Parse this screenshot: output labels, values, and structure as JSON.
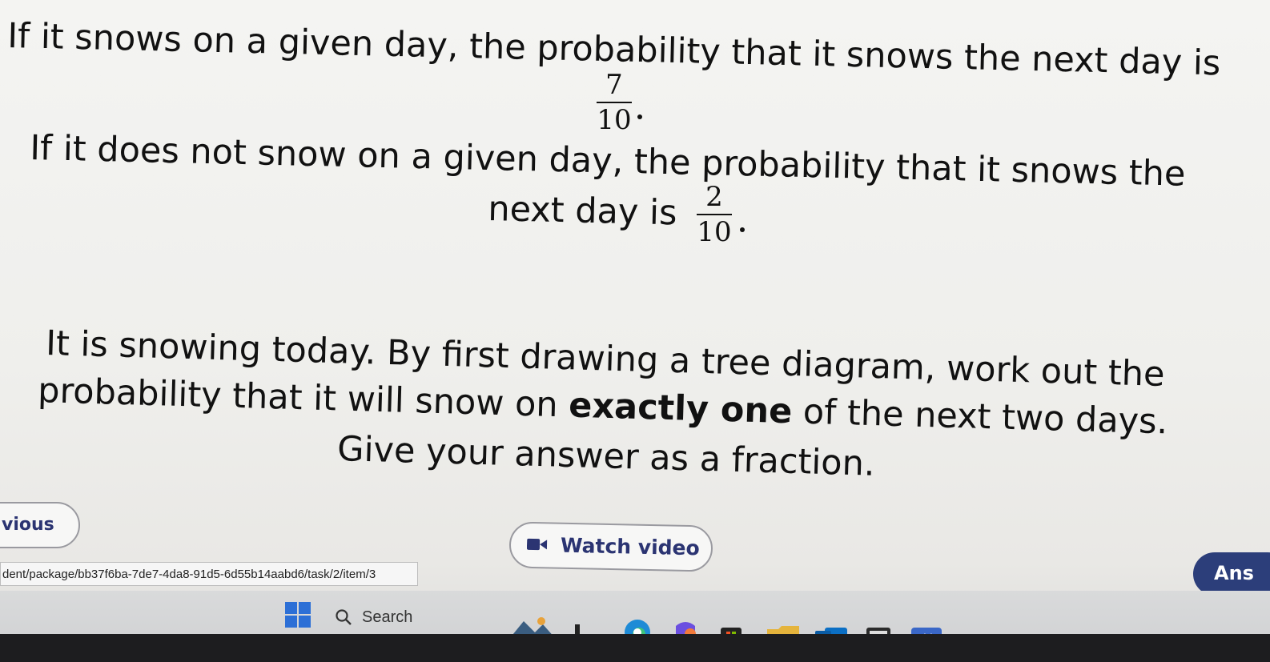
{
  "question": {
    "line1": "If it snows on a given day, the probability that it snows the next day is",
    "frac1": {
      "num": "7",
      "den": "10"
    },
    "line2": "If it does not snow on a given day, the probability that it snows the",
    "line3": "next day is",
    "frac2": {
      "num": "2",
      "den": "10"
    },
    "line4": "It is snowing today. By first drawing a tree diagram, work out the",
    "line5_before": "probability that it will snow on ",
    "line5_bold": "exactly one",
    "line5_after": " of the next two days.",
    "line6": "Give your answer as a fraction."
  },
  "buttons": {
    "previous": "vious",
    "watch_video": "Watch video",
    "answer": "Ans"
  },
  "url_tooltip": "dent/package/bb37f6ba-7de7-4da8-91d5-6d55b14aabd6/task/2/item/3",
  "taskbar": {
    "search_placeholder": "Search",
    "icons": [
      "windows-start-icon",
      "search-icon",
      "photos-icon",
      "file-explorer-icon",
      "edge-icon",
      "copilot-icon",
      "store-icon",
      "folder-icon",
      "outlook-icon",
      "calculator-icon",
      "whiteboard-icon"
    ]
  },
  "colors": {
    "button_text": "#2b3472",
    "answer_button_bg": "#2c3e7a"
  }
}
